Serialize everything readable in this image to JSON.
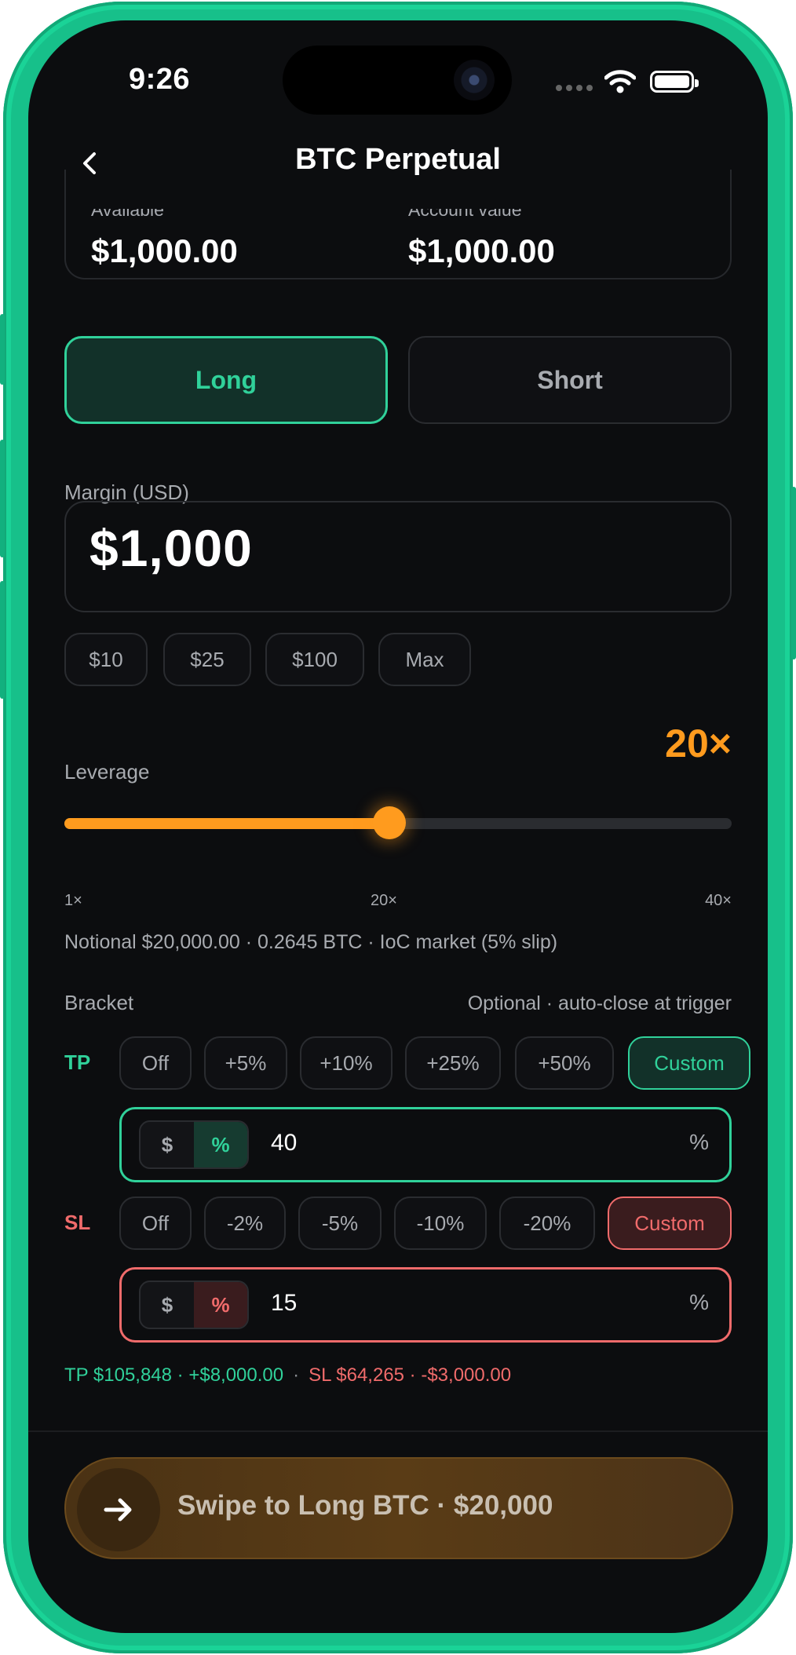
{
  "status_bar": {
    "time": "9:26"
  },
  "header": {
    "title": "BTC Perpetual"
  },
  "balances": {
    "available_label": "Available",
    "available_value": "$1,000.00",
    "account_label": "Account value",
    "account_value": "$1,000.00"
  },
  "direction": {
    "long_label": "Long",
    "short_label": "Short",
    "selected": "Long"
  },
  "margin": {
    "label": "Margin (USD)",
    "value": "$1,000",
    "presets": [
      "$10",
      "$25",
      "$100",
      "Max"
    ]
  },
  "leverage": {
    "label": "Leverage",
    "value": "20×",
    "level": 20,
    "min": 1,
    "max": 40,
    "ticks": [
      "1×",
      "20×",
      "40×"
    ]
  },
  "notional_text": "Notional $20,000.00 · 0.2645 BTC · IoC market (5% slip)",
  "bracket": {
    "label": "Bracket",
    "hint": "Optional · auto-close at trigger",
    "tp": {
      "label": "TP",
      "options": [
        "Off",
        "+5%",
        "+10%",
        "+25%",
        "+50%",
        "Custom"
      ],
      "selected": "Custom",
      "mode_dollar": "$",
      "mode_percent": "%",
      "mode_selected": "%",
      "value": "40",
      "unit": "%"
    },
    "sl": {
      "label": "SL",
      "options": [
        "Off",
        "-2%",
        "-5%",
        "-10%",
        "-20%",
        "Custom"
      ],
      "selected": "Custom",
      "mode_dollar": "$",
      "mode_percent": "%",
      "mode_selected": "%",
      "value": "15",
      "unit": "%"
    },
    "summary": {
      "tp": "TP $105,848 · +$8,000.00",
      "separator": "·",
      "sl": "SL $64,265 · -$3,000.00"
    }
  },
  "swipe": {
    "label": "Swipe to Long BTC  ·  $20,000"
  },
  "colors": {
    "accent_green": "#30d19a",
    "accent_orange": "#ff9b1e",
    "accent_red": "#f06b6b",
    "frame": "#17c08a"
  }
}
